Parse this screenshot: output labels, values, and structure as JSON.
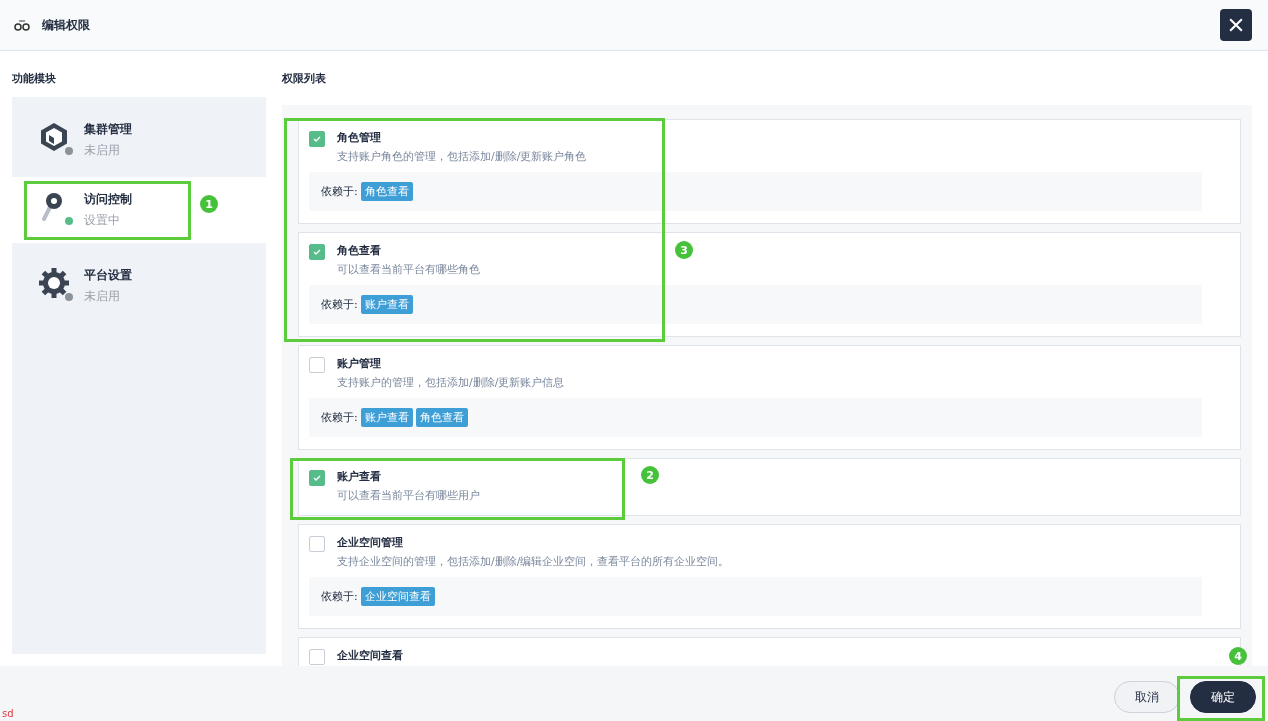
{
  "window": {
    "title": "编辑权限"
  },
  "modules": {
    "heading": "功能模块",
    "items": [
      {
        "name": "集群管理",
        "status": "未启用",
        "selected": false,
        "color": "#8a929c"
      },
      {
        "name": "访问控制",
        "status": "设置中",
        "selected": true,
        "color": "#55bc8a"
      },
      {
        "name": "平台设置",
        "status": "未启用",
        "selected": false,
        "color": "#8a929c"
      }
    ]
  },
  "permissions": {
    "heading": "权限列表",
    "items": [
      {
        "name": "角色管理",
        "description": "支持账户角色的管理，包括添加/删除/更新账户角色",
        "checked": true,
        "depends_label": "依赖于:",
        "depends_on": [
          "角色查看"
        ]
      },
      {
        "name": "角色查看",
        "description": "可以查看当前平台有哪些角色",
        "checked": true,
        "depends_label": "依赖于:",
        "depends_on": [
          "账户查看"
        ]
      },
      {
        "name": "账户管理",
        "description": "支持账户的管理，包括添加/删除/更新账户信息",
        "checked": false,
        "depends_label": "依赖于:",
        "depends_on": [
          "账户查看",
          "角色查看"
        ]
      },
      {
        "name": "账户查看",
        "description": "可以查看当前平台有哪些用户",
        "checked": true
      },
      {
        "name": "企业空间管理",
        "description": "支持企业空间的管理，包括添加/删除/编辑企业空间，查看平台的所有企业空间。",
        "checked": false,
        "depends_label": "依赖于:",
        "depends_on": [
          "企业空间查看"
        ]
      },
      {
        "name": "企业空间查看",
        "checked": false
      }
    ]
  },
  "footer": {
    "buttons": [
      {
        "label": "取消",
        "kind": "secondary"
      },
      {
        "label": "确定",
        "kind": "primary"
      }
    ],
    "note": "sd"
  },
  "annotations": [
    "1",
    "3",
    "2",
    "4"
  ]
}
